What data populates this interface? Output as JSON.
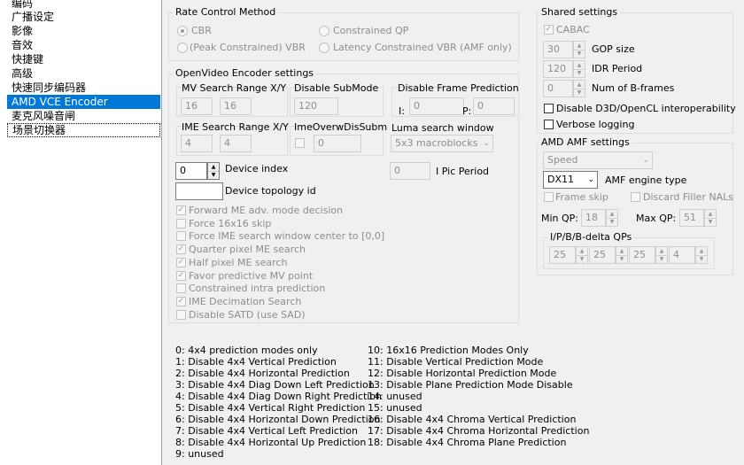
{
  "sidebar": {
    "items": [
      "编码",
      "广播设定",
      "影像",
      "音效",
      "快捷键",
      "高级",
      "快速同步编码器",
      "AMD VCE Encoder",
      "麦克风噪音闸",
      "场景切换器"
    ],
    "selected_index": 7
  },
  "rate_control": {
    "title": "Rate Control Method",
    "cbr": "CBR",
    "constrained_qp": "Constrained QP",
    "peak_vbr": "(Peak Constrained) VBR",
    "latency_vbr": "Latency Constrained VBR (AMF only)"
  },
  "openvideo": {
    "title": "OpenVideo Encoder settings",
    "mv_search_label": "MV Search Range X/Y",
    "mv_x": "16",
    "mv_y": "16",
    "disable_submode_label": "Disable SubMode",
    "disable_submode_value": "120",
    "disable_frame_pred_label": "Disable Frame Prediction",
    "i_label": "I:",
    "i_value": "0",
    "p_label": "P:",
    "p_value": "0",
    "ime_search_label": "IME Search Range X/Y",
    "ime_x": "4",
    "ime_y": "4",
    "ime_overw_label": "ImeOverwDisSubm",
    "ime_overw_value": "0",
    "luma_label": "Luma search window",
    "luma_value": "5x3 macroblocks",
    "device_index_value": "0",
    "device_index_label": "Device index",
    "device_topology_label": "Device topology id",
    "device_topology_value": "",
    "ipic_value": "0",
    "ipic_label": "I Pic Period",
    "checkboxes": [
      {
        "label": "Forward ME adv. mode decision",
        "checked": true
      },
      {
        "label": "Force 16x16 skip",
        "checked": false
      },
      {
        "label": "Force IME search window center to [0,0]",
        "checked": false
      },
      {
        "label": "Quarter pixel ME search",
        "checked": true
      },
      {
        "label": "Half pixel ME search",
        "checked": true
      },
      {
        "label": "Favor predictive MV point",
        "checked": true
      },
      {
        "label": "Constrained intra prediction",
        "checked": false
      },
      {
        "label": "IME Decimation Search",
        "checked": true
      },
      {
        "label": "Disable SATD (use SAD)",
        "checked": false
      }
    ]
  },
  "shared": {
    "title": "Shared settings",
    "cabac_label": "CABAC",
    "gop_value": "30",
    "gop_label": "GOP size",
    "idr_value": "120",
    "idr_label": "IDR Period",
    "bframes_value": "0",
    "bframes_label": "Num of B-frames",
    "disable_d3d_label": "Disable D3D/OpenCL interoperability",
    "verbose_label": "Verbose logging"
  },
  "amf": {
    "title": "AMD AMF settings",
    "preset_value": "Speed",
    "engine_value": "DX11",
    "engine_label": "AMF engine type",
    "frame_skip_label": "Frame skip",
    "discard_filler_label": "Discard Filler NALs",
    "min_qp_label": "Min QP:",
    "min_qp_value": "18",
    "max_qp_label": "Max QP:",
    "max_qp_value": "51",
    "delta_title": "I/P/B/B-delta QPs",
    "delta_values": [
      "25",
      "25",
      "25",
      "4"
    ]
  },
  "modes_left": [
    "0: 4x4 prediction modes only",
    "1: Disable 4x4 Vertical Prediction",
    "2: Disable 4x4 Horizontal Prediction",
    "3: Disable 4x4 Diag Down Left Prediction",
    "4: Disable 4x4 Diag Down Right Prediction",
    "5: Disable 4x4 Vertical Right Prediction",
    "6: Disable 4x4 Horizontal Down Prediction",
    "7: Disable 4x4 Vertical Left Prediction",
    "8: Disable 4x4 Horizontal Up Prediction",
    "9: unused"
  ],
  "modes_right": [
    "10: 16x16 Prediction Modes Only",
    "11: Disable Vertical Prediction Mode",
    "12: Disable Horizontal Prediction Mode",
    "13: Disable Plane Prediction Mode Disable",
    "14: unused",
    "15: unused",
    "16: Disable 4x4 Chroma Vertical Prediction",
    "17: Disable 4x4 Chroma Horizontal Prediction",
    "18: Disable 4x4 Chroma Plane Prediction"
  ]
}
